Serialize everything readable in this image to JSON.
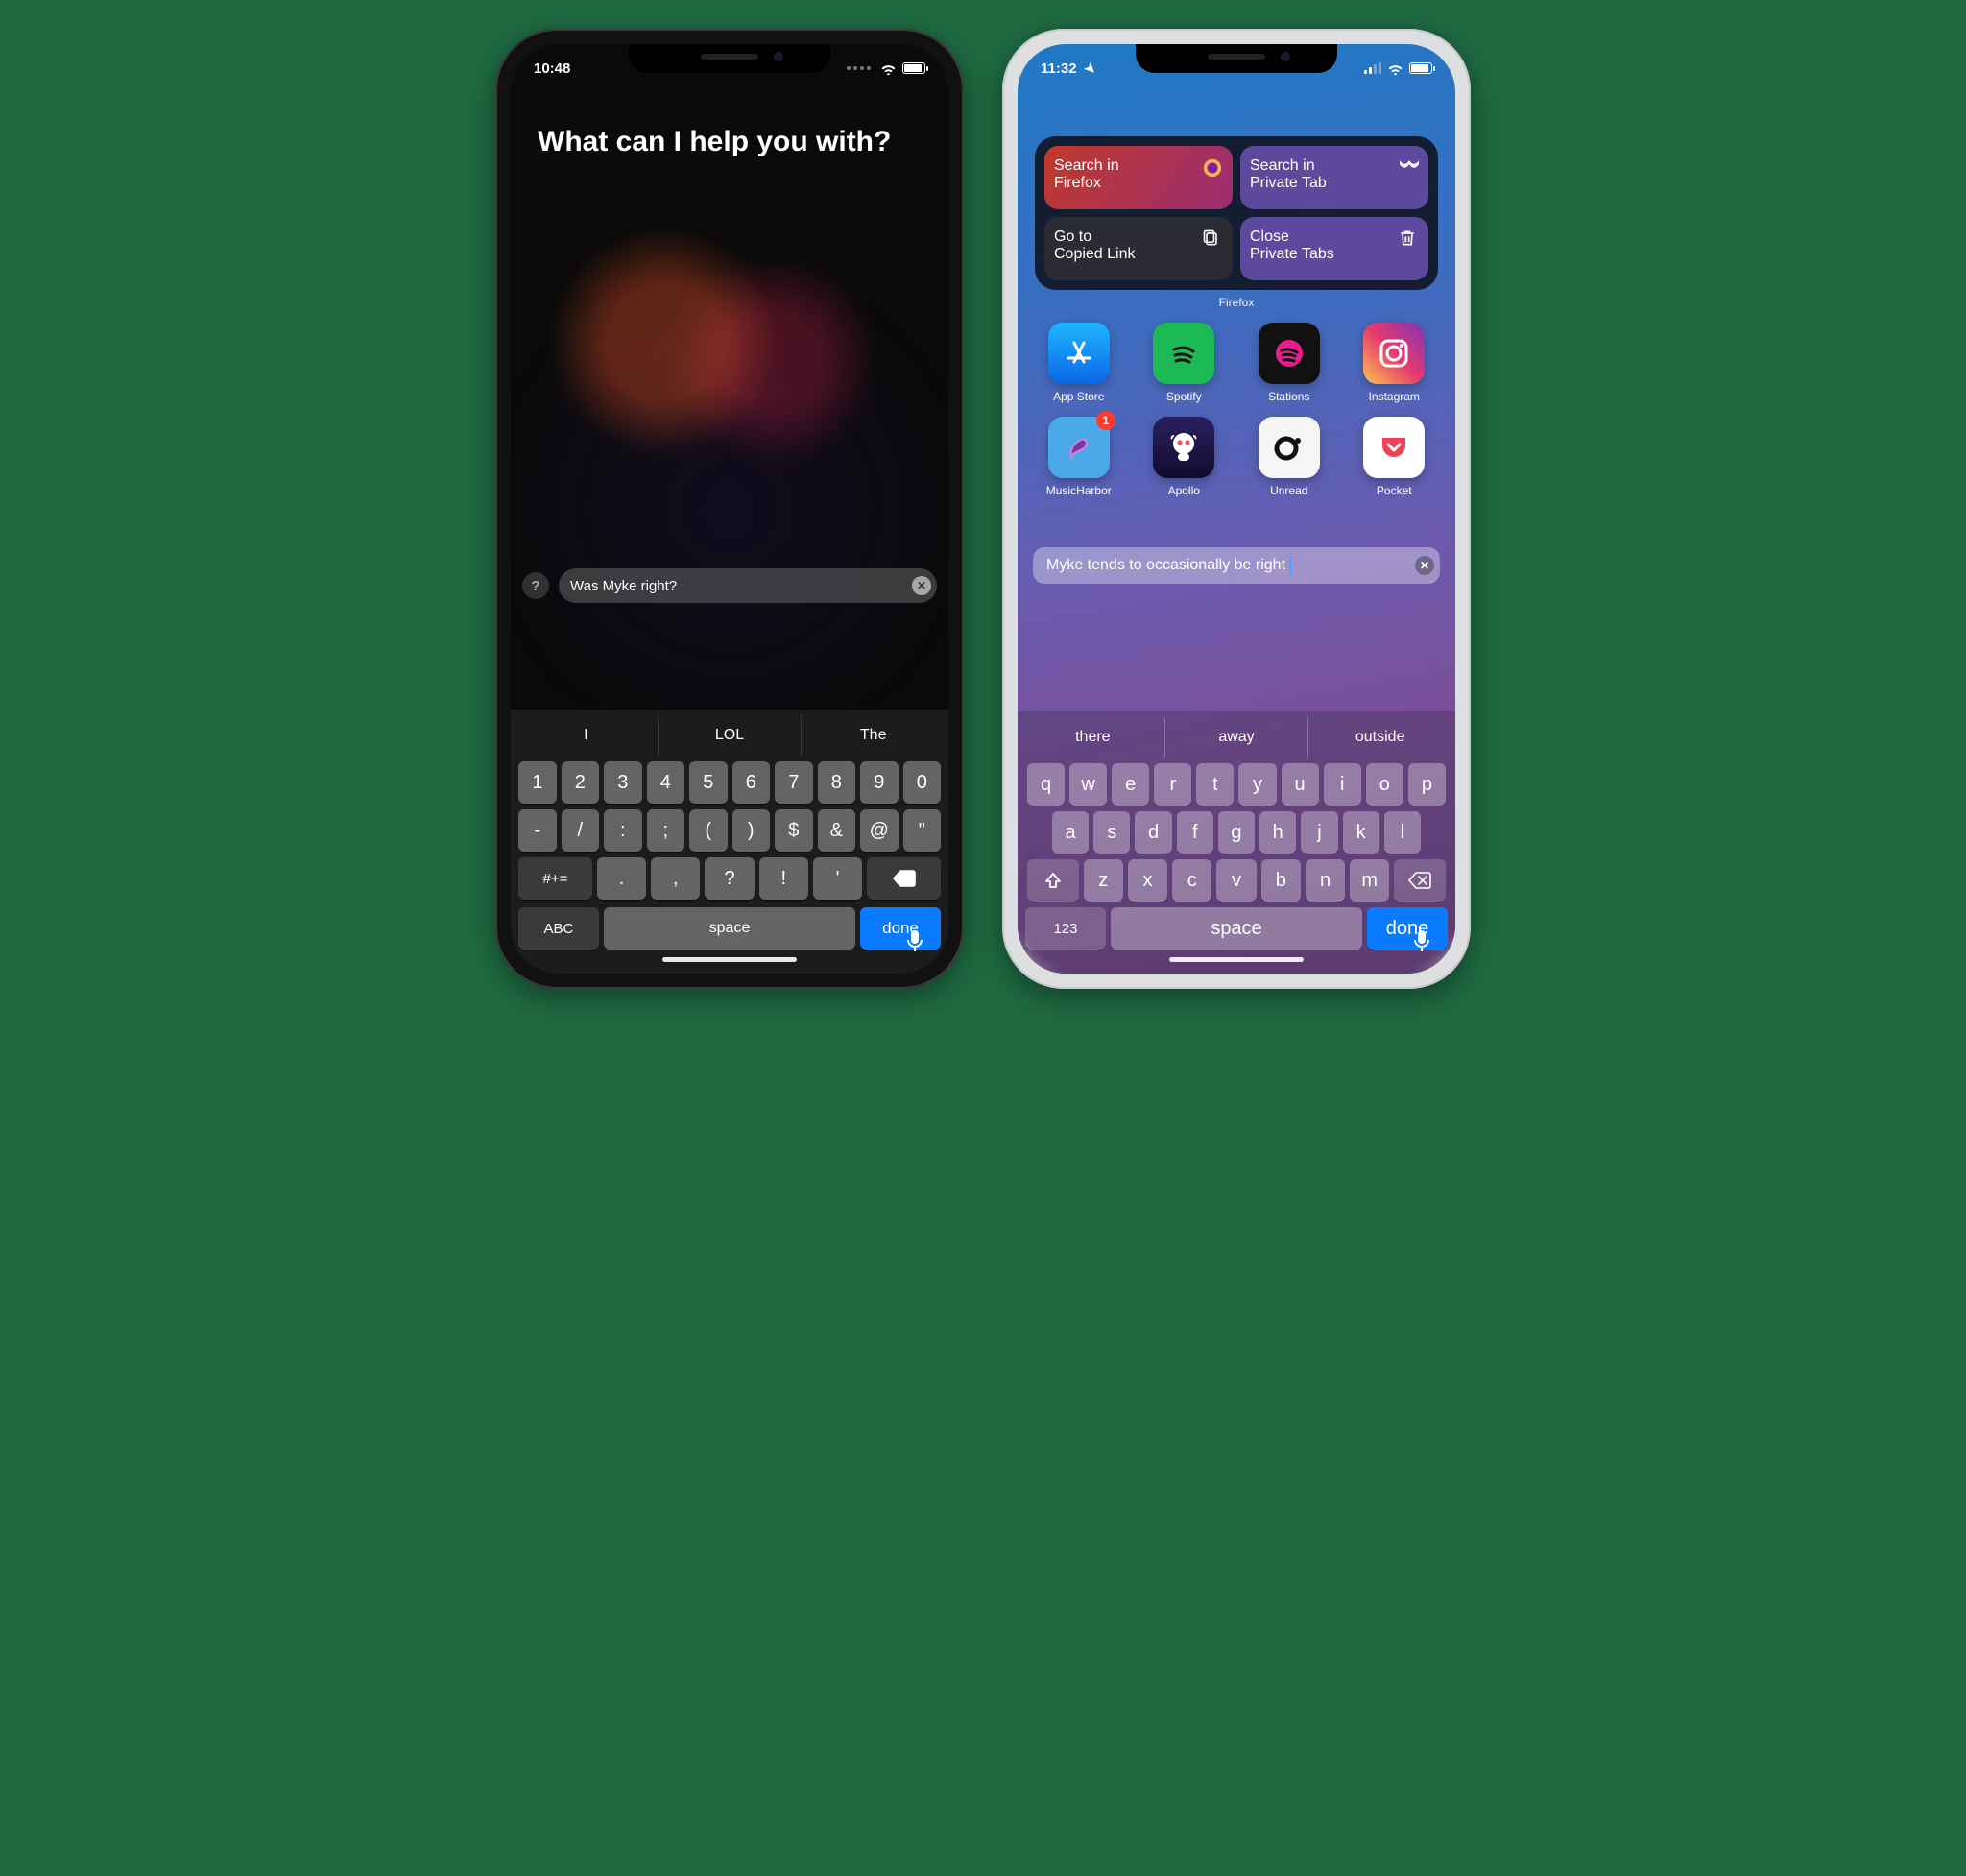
{
  "left": {
    "status": {
      "time": "10:48"
    },
    "prompt": "What can I help you with?",
    "help_glyph": "?",
    "input_value": "Was Myke right?",
    "suggestions": [
      "I",
      "LOL",
      "The"
    ],
    "key_rows": {
      "r1": [
        "1",
        "2",
        "3",
        "4",
        "5",
        "6",
        "7",
        "8",
        "9",
        "0"
      ],
      "r2": [
        "-",
        "/",
        ":",
        ";",
        "(",
        ")",
        "$",
        "&",
        "@",
        "\""
      ],
      "r3_fn": "#+=",
      "r3": [
        ".",
        ",",
        "?",
        "!",
        "'"
      ],
      "abc": "ABC",
      "space": "space",
      "done": "done"
    }
  },
  "right": {
    "status": {
      "time": "11:32"
    },
    "widget": {
      "tiles": [
        {
          "title": "Search in",
          "sub": "Firefox"
        },
        {
          "title": "Search in",
          "sub": "Private Tab"
        },
        {
          "title": "Go to",
          "sub": "Copied Link"
        },
        {
          "title": "Close",
          "sub": "Private Tabs"
        }
      ],
      "label": "Firefox"
    },
    "apps": [
      {
        "name": "App Store"
      },
      {
        "name": "Spotify"
      },
      {
        "name": "Stations"
      },
      {
        "name": "Instagram"
      },
      {
        "name": "MusicHarbor",
        "badge": "1"
      },
      {
        "name": "Apollo"
      },
      {
        "name": "Unread"
      },
      {
        "name": "Pocket"
      }
    ],
    "spotlight_value": "Myke tends to occasionally be right",
    "suggestions": [
      "there",
      "away",
      "outside"
    ],
    "key_rows": {
      "r1": [
        "q",
        "w",
        "e",
        "r",
        "t",
        "y",
        "u",
        "i",
        "o",
        "p"
      ],
      "r2": [
        "a",
        "s",
        "d",
        "f",
        "g",
        "h",
        "j",
        "k",
        "l"
      ],
      "r3": [
        "z",
        "x",
        "c",
        "v",
        "b",
        "n",
        "m"
      ],
      "num": "123",
      "space": "space",
      "done": "done"
    }
  }
}
